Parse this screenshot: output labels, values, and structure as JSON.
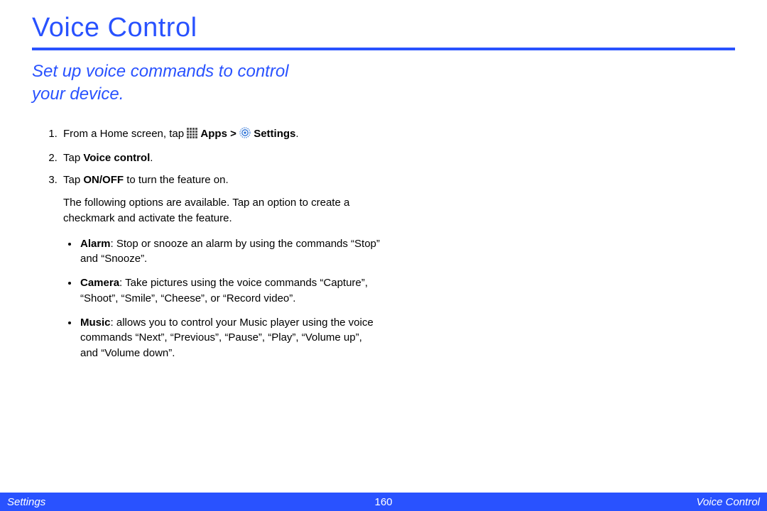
{
  "title": "Voice Control",
  "subtitle_line1": "Set up voice commands to control",
  "subtitle_line2": "your device.",
  "step1_prefix": "From a Home screen, tap ",
  "step1_apps": "Apps",
  "step1_sep": " > ",
  "step1_settings": "Settings",
  "step1_period": ".",
  "step2_prefix": "Tap ",
  "step2_bold": "Voice control",
  "step2_period": ".",
  "step3_prefix": "Tap ",
  "step3_bold": "ON/OFF",
  "step3_suffix": " to turn the feature on.",
  "options_intro": "The following options are available. Tap an option to create a checkmark and activate the feature.",
  "bullets": {
    "alarm_label": "Alarm",
    "alarm_text": ": Stop or snooze an alarm by using the commands “Stop” and “Snooze”.",
    "camera_label": "Camera",
    "camera_text": ": Take pictures using the voice commands “Capture”, “Shoot”, “Smile”, “Cheese”, or “Record video”.",
    "music_label": "Music",
    "music_text": ": allows you to control your Music player using the voice commands “Next”, “Previous”, “Pause”, “Play”, “Volume up”, and “Volume down”."
  },
  "footer": {
    "left": "Settings",
    "page": "160",
    "right": "Voice Control"
  }
}
